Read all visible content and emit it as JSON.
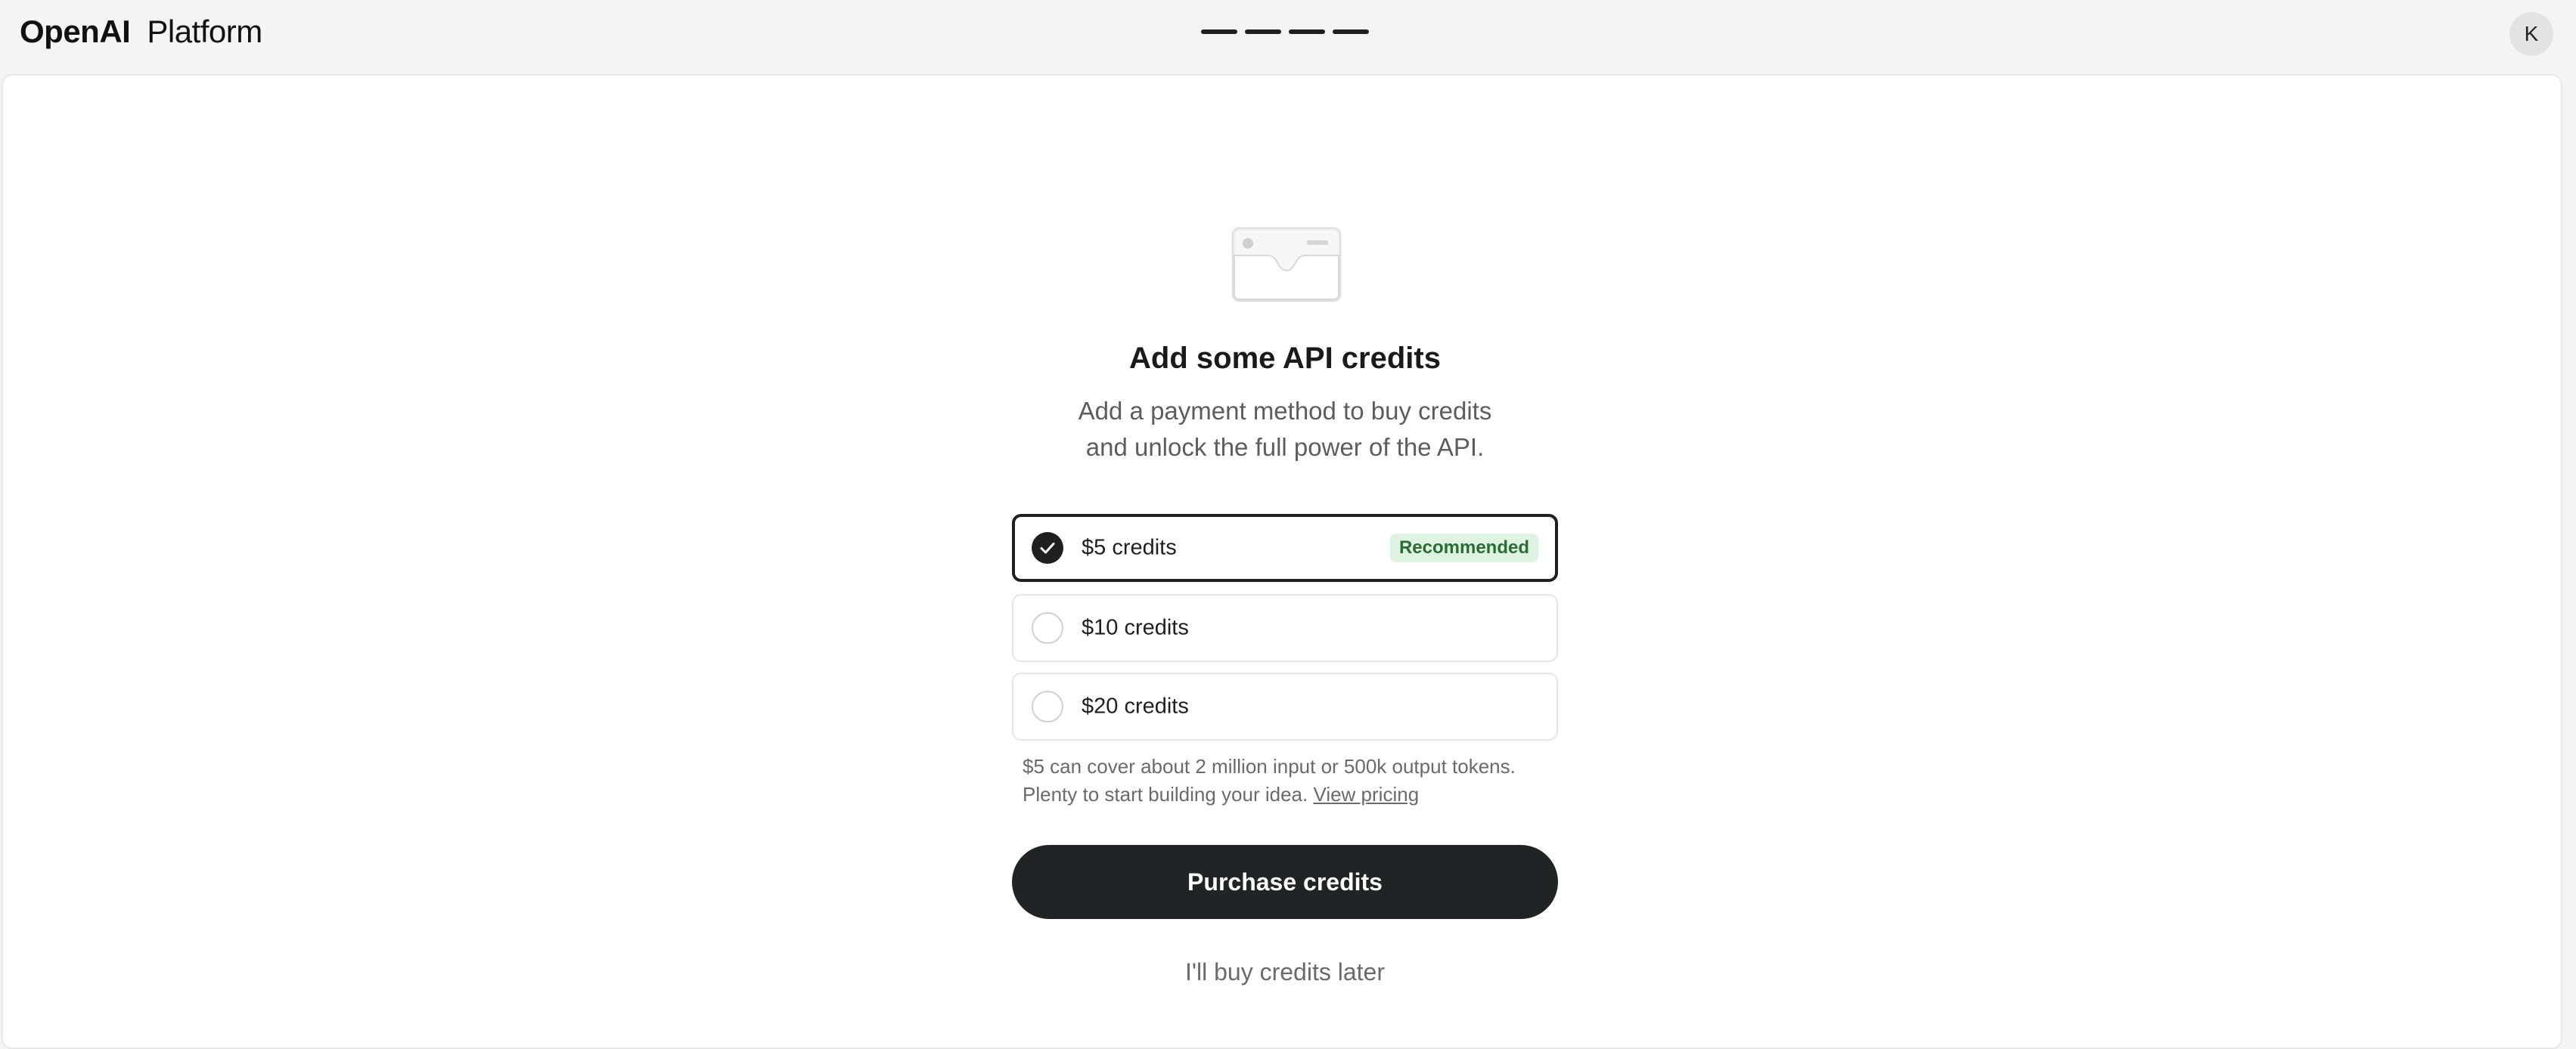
{
  "header": {
    "brand_name": "OpenAI",
    "brand_product": "Platform",
    "progress_steps_total": 4,
    "progress_steps_completed": 4,
    "avatar_initial": "K"
  },
  "main": {
    "illustration_icon": "credit-card-icon",
    "title": "Add some API credits",
    "subtitle_line1": "Add a payment method to buy credits",
    "subtitle_line2": "and unlock the full power of the API.",
    "options": [
      {
        "label": "$5 credits",
        "selected": true,
        "badge": "Recommended"
      },
      {
        "label": "$10 credits",
        "selected": false
      },
      {
        "label": "$20 credits",
        "selected": false
      }
    ],
    "note_line1": "$5 can cover about 2 million input or 500k output tokens.",
    "note_line2": "Plenty to start building your idea.",
    "note_link": "View pricing",
    "purchase_label": "Purchase credits",
    "later_label": "I'll buy credits later"
  },
  "colors": {
    "primary": "#1f1f1f",
    "badge_bg": "#dff3e1",
    "badge_text": "#2a6b36",
    "page_bg": "#f4f4f4",
    "muted_text": "#6a6a6a"
  }
}
